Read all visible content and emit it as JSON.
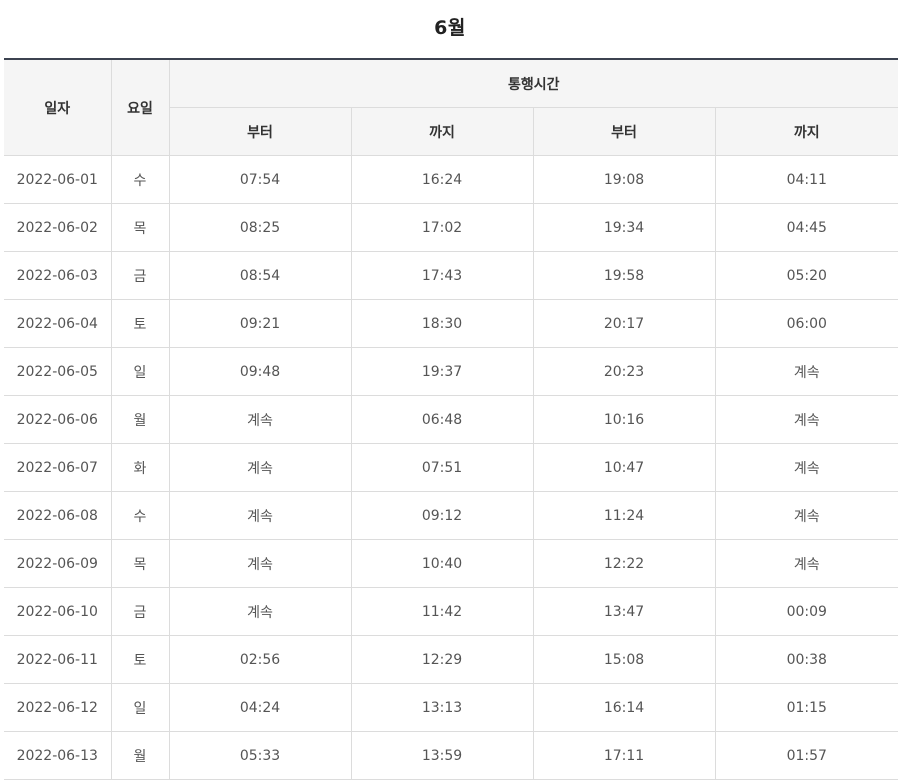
{
  "title": "6월",
  "headers": {
    "date": "일자",
    "weekday": "요일",
    "group": "통행시간",
    "from1": "부터",
    "to1": "까지",
    "from2": "부터",
    "to2": "까지"
  },
  "rows": [
    {
      "date": "2022-06-01",
      "day": "수",
      "from1": "07:54",
      "to1": "16:24",
      "from2": "19:08",
      "to2": "04:11"
    },
    {
      "date": "2022-06-02",
      "day": "목",
      "from1": "08:25",
      "to1": "17:02",
      "from2": "19:34",
      "to2": "04:45"
    },
    {
      "date": "2022-06-03",
      "day": "금",
      "from1": "08:54",
      "to1": "17:43",
      "from2": "19:58",
      "to2": "05:20"
    },
    {
      "date": "2022-06-04",
      "day": "토",
      "from1": "09:21",
      "to1": "18:30",
      "from2": "20:17",
      "to2": "06:00"
    },
    {
      "date": "2022-06-05",
      "day": "일",
      "from1": "09:48",
      "to1": "19:37",
      "from2": "20:23",
      "to2": "계속"
    },
    {
      "date": "2022-06-06",
      "day": "월",
      "from1": "계속",
      "to1": "06:48",
      "from2": "10:16",
      "to2": "계속"
    },
    {
      "date": "2022-06-07",
      "day": "화",
      "from1": "계속",
      "to1": "07:51",
      "from2": "10:47",
      "to2": "계속"
    },
    {
      "date": "2022-06-08",
      "day": "수",
      "from1": "계속",
      "to1": "09:12",
      "from2": "11:24",
      "to2": "계속"
    },
    {
      "date": "2022-06-09",
      "day": "목",
      "from1": "계속",
      "to1": "10:40",
      "from2": "12:22",
      "to2": "계속"
    },
    {
      "date": "2022-06-10",
      "day": "금",
      "from1": "계속",
      "to1": "11:42",
      "from2": "13:47",
      "to2": "00:09"
    },
    {
      "date": "2022-06-11",
      "day": "토",
      "from1": "02:56",
      "to1": "12:29",
      "from2": "15:08",
      "to2": "00:38"
    },
    {
      "date": "2022-06-12",
      "day": "일",
      "from1": "04:24",
      "to1": "13:13",
      "from2": "16:14",
      "to2": "01:15"
    },
    {
      "date": "2022-06-13",
      "day": "월",
      "from1": "05:33",
      "to1": "13:59",
      "from2": "17:11",
      "to2": "01:57"
    }
  ]
}
